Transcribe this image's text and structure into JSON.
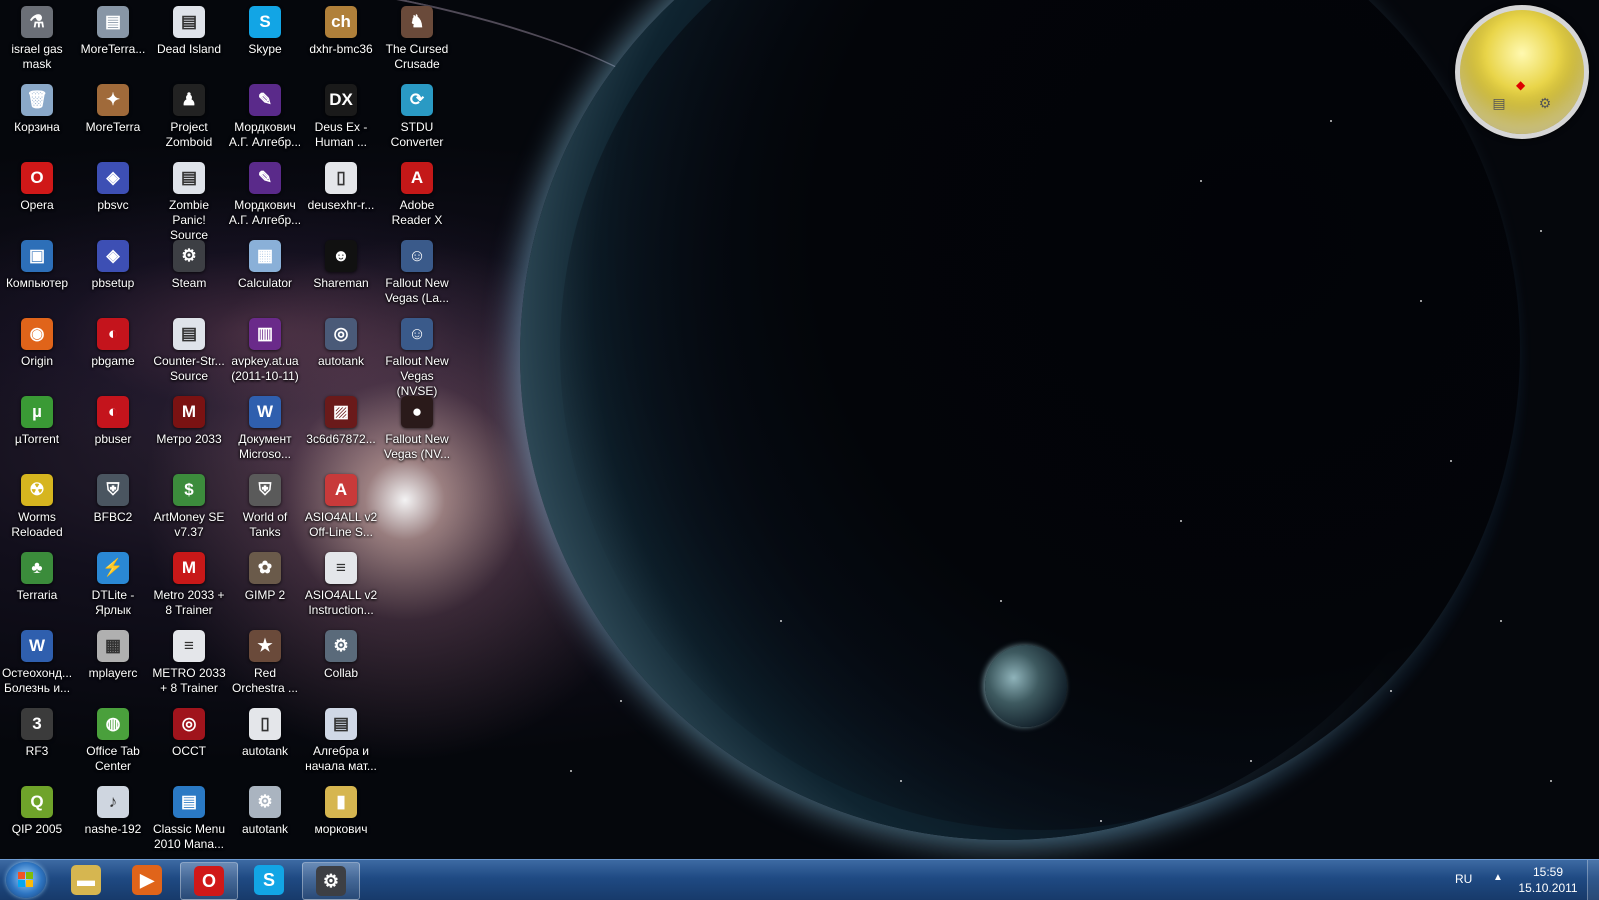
{
  "desktop": {
    "columns": [
      [
        {
          "label": "israel gas mask",
          "icon": "shortcut-icon",
          "color": "#6b6f77",
          "glyph": "⚗"
        },
        {
          "label": "Корзина",
          "icon": "recycle-bin-icon",
          "color": "#8aa8c8",
          "glyph": "🗑"
        },
        {
          "label": "Opera",
          "icon": "opera-icon",
          "color": "#d01818",
          "glyph": "O"
        },
        {
          "label": "Компьютер",
          "icon": "computer-icon",
          "color": "#2d6fb8",
          "glyph": "▣"
        },
        {
          "label": "Origin",
          "icon": "origin-icon",
          "color": "#e0641a",
          "glyph": "◉"
        },
        {
          "label": "µTorrent",
          "icon": "utorrent-icon",
          "color": "#3a9a35",
          "glyph": "µ"
        },
        {
          "label": "Worms Reloaded",
          "icon": "worms-icon",
          "color": "#d6b51f",
          "glyph": "☢"
        },
        {
          "label": "Terraria",
          "icon": "terraria-icon",
          "color": "#3b8c3b",
          "glyph": "♣"
        },
        {
          "label": "Остеохонд... Болезнь и...",
          "icon": "word-doc-icon",
          "color": "#2f5fae",
          "glyph": "W"
        },
        {
          "label": "RF3",
          "icon": "rf3-icon",
          "color": "#3b3b3b",
          "glyph": "3"
        },
        {
          "label": "QIP 2005",
          "icon": "qip-icon",
          "color": "#6fa32a",
          "glyph": "Q"
        }
      ],
      [
        {
          "label": "MoreTerra...",
          "icon": "image-file-icon",
          "color": "#8896a6",
          "glyph": "▤"
        },
        {
          "label": "MoreTerra",
          "icon": "moreterra-icon",
          "color": "#a06a3a",
          "glyph": "✦"
        },
        {
          "label": "pbsvc",
          "icon": "punkbuster-icon",
          "color": "#3d4fb4",
          "glyph": "◈"
        },
        {
          "label": "pbsetup",
          "icon": "punkbuster-setup-icon",
          "color": "#3d4fb4",
          "glyph": "◈"
        },
        {
          "label": "pbgame",
          "icon": "pbgame-icon",
          "color": "#c4141c",
          "glyph": "◐"
        },
        {
          "label": "pbuser",
          "icon": "pbuser-icon",
          "color": "#c4141c",
          "glyph": "◐"
        },
        {
          "label": "BFBC2",
          "icon": "bfbc2-icon",
          "color": "#4a5560",
          "glyph": "⛨"
        },
        {
          "label": "DTLite - Ярлык",
          "icon": "daemon-tools-icon",
          "color": "#2a88d4",
          "glyph": "⚡"
        },
        {
          "label": "mplayerc",
          "icon": "mplayer-icon",
          "color": "#b0b0b0",
          "glyph": "▦"
        },
        {
          "label": "Office Tab Center",
          "icon": "office-tab-icon",
          "color": "#4aa03c",
          "glyph": "◍"
        },
        {
          "label": "nashe-192",
          "icon": "playlist-icon",
          "color": "#cfd6e0",
          "glyph": "♪"
        }
      ],
      [
        {
          "label": "Dead Island",
          "icon": "dead-island-icon",
          "color": "#dfe3ea",
          "glyph": "▤"
        },
        {
          "label": "Project Zomboid",
          "icon": "project-zomboid-icon",
          "color": "#222",
          "glyph": "♟"
        },
        {
          "label": "Zombie Panic! Source",
          "icon": "zombie-panic-icon",
          "color": "#dfe3ea",
          "glyph": "▤"
        },
        {
          "label": "Steam",
          "icon": "steam-icon",
          "color": "#3d3f44",
          "glyph": "⚙"
        },
        {
          "label": "Counter-Str... Source",
          "icon": "counter-strike-icon",
          "color": "#dfe3ea",
          "glyph": "▤"
        },
        {
          "label": "Метро 2033",
          "icon": "metro-2033-icon",
          "color": "#7a1212",
          "glyph": "M"
        },
        {
          "label": "ArtMoney SE v7.37",
          "icon": "artmoney-icon",
          "color": "#3c8c3c",
          "glyph": "$"
        },
        {
          "label": "Metro 2033 + 8 Trainer",
          "icon": "metro-trainer-icon",
          "color": "#c81818",
          "glyph": "M"
        },
        {
          "label": "METRO 2033 + 8 Trainer",
          "icon": "text-file-icon",
          "color": "#e4e6ea",
          "glyph": "≡"
        },
        {
          "label": "OCCT",
          "icon": "occt-icon",
          "color": "#a0141c",
          "glyph": "◎"
        },
        {
          "label": "Classic Menu 2010 Mana...",
          "icon": "classic-menu-icon",
          "color": "#2a79c4",
          "glyph": "▤"
        }
      ],
      [
        {
          "label": "Skype",
          "icon": "skype-icon",
          "color": "#12a5e5",
          "glyph": "S"
        },
        {
          "label": "Мордкович А.Г. Алгебр...",
          "icon": "djvu-icon",
          "color": "#5a2a8a",
          "glyph": "✎"
        },
        {
          "label": "Мордкович А.Г. Алгебр...",
          "icon": "djvu-icon",
          "color": "#5a2a8a",
          "glyph": "✎"
        },
        {
          "label": "Calculator",
          "icon": "calculator-icon",
          "color": "#8ab0d8",
          "glyph": "▦"
        },
        {
          "label": "avpkey.at.ua (2011-10-11)",
          "icon": "winrar-icon",
          "color": "#6a2a8a",
          "glyph": "▥"
        },
        {
          "label": "Документ Microso...",
          "icon": "word-doc-icon",
          "color": "#2f5fae",
          "glyph": "W"
        },
        {
          "label": "World of Tanks",
          "icon": "world-of-tanks-icon",
          "color": "#5a5a5a",
          "glyph": "⛨"
        },
        {
          "label": "GIMP 2",
          "icon": "gimp-icon",
          "color": "#6a5a4a",
          "glyph": "✿"
        },
        {
          "label": "Red Orchestra ...",
          "icon": "red-orchestra-icon",
          "color": "#6a4a3a",
          "glyph": "★"
        },
        {
          "label": "autotank",
          "icon": "file-icon",
          "color": "#e4e6ea",
          "glyph": "▯"
        },
        {
          "label": "autotank",
          "icon": "settings-file-icon",
          "color": "#aab4c0",
          "glyph": "⚙"
        }
      ],
      [
        {
          "label": "dxhr-bmc36",
          "icon": "dxhr-icon",
          "color": "#b0803a",
          "glyph": "ch"
        },
        {
          "label": "Deus Ex - Human ...",
          "icon": "deus-ex-icon",
          "color": "#1a1a1a",
          "glyph": "DX"
        },
        {
          "label": "deusexhr-r...",
          "icon": "file-icon",
          "color": "#e4e6ea",
          "glyph": "▯"
        },
        {
          "label": "Shareman",
          "icon": "shareman-icon",
          "color": "#111",
          "glyph": "☻"
        },
        {
          "label": "autotank",
          "icon": "autotank-icon",
          "color": "#4a5a78",
          "glyph": "◎"
        },
        {
          "label": "3c6d67872...",
          "icon": "image-file-icon",
          "color": "#6a1a1a",
          "glyph": "▨"
        },
        {
          "label": "ASIO4ALL v2 Off-Line S...",
          "icon": "asio-icon",
          "color": "#c83a3a",
          "glyph": "A"
        },
        {
          "label": "ASIO4ALL v2 Instruction...",
          "icon": "text-file-icon",
          "color": "#e4e6ea",
          "glyph": "≡"
        },
        {
          "label": "Collab",
          "icon": "collab-icon",
          "color": "#5a6a7a",
          "glyph": "⚙"
        },
        {
          "label": "Алгебра и начала мат...",
          "icon": "doc-icon",
          "color": "#d0d8e6",
          "glyph": "▤"
        },
        {
          "label": "моркович",
          "icon": "folder-icon",
          "color": "#d6b650",
          "glyph": "▮"
        }
      ],
      [
        {
          "label": "The Cursed Crusade",
          "icon": "cursed-crusade-icon",
          "color": "#6a4a3a",
          "glyph": "♞"
        },
        {
          "label": "STDU Converter",
          "icon": "stdu-converter-icon",
          "color": "#2a9ac4",
          "glyph": "⟳"
        },
        {
          "label": "Adobe Reader X",
          "icon": "adobe-reader-icon",
          "color": "#c41818",
          "glyph": "A"
        },
        {
          "label": "Fallout New Vegas (La...",
          "icon": "fallout-icon",
          "color": "#3a5a8a",
          "glyph": "☺"
        },
        {
          "label": "Fallout New Vegas (NVSE)",
          "icon": "fallout-icon",
          "color": "#3a5a8a",
          "glyph": "☺"
        },
        {
          "label": "Fallout New Vegas (NV...",
          "icon": "fallout-nv-icon",
          "color": "#2a1a1a",
          "glyph": "●"
        }
      ]
    ]
  },
  "gadget": {
    "name": "cpu-meter-gadget"
  },
  "taskbar": {
    "pinned": [
      {
        "name": "explorer",
        "icon": "explorer-folder-icon",
        "color": "#d6b650",
        "glyph": "▬",
        "active": false
      },
      {
        "name": "media-player",
        "icon": "media-player-icon",
        "color": "#e0641a",
        "glyph": "▶",
        "active": false
      },
      {
        "name": "opera",
        "icon": "opera-icon",
        "color": "#d01818",
        "glyph": "O",
        "active": true
      },
      {
        "name": "skype",
        "icon": "skype-icon",
        "color": "#12a5e5",
        "glyph": "S",
        "active": false
      },
      {
        "name": "steam",
        "icon": "steam-icon",
        "color": "#3d3f44",
        "glyph": "⚙",
        "active": true
      }
    ],
    "language": "RU",
    "time": "15:59",
    "date": "15.10.2011"
  }
}
